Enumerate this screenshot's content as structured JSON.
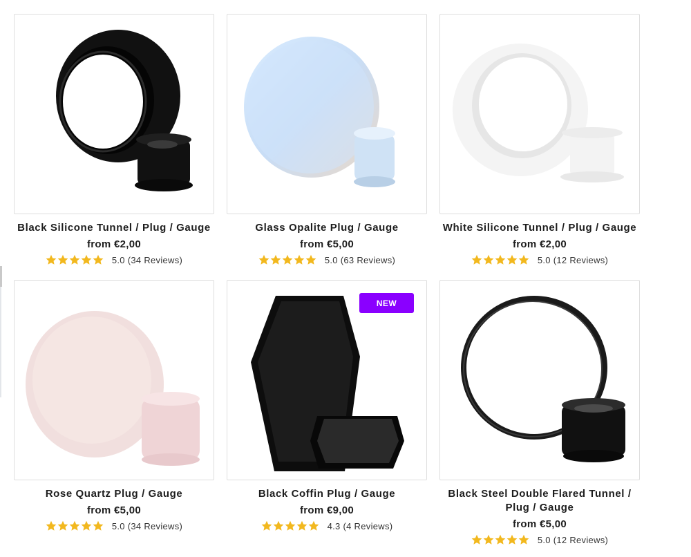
{
  "colors": {
    "star": "#f2b81e",
    "badge": "#8a00ff",
    "border": "#dedede"
  },
  "products": [
    {
      "title": "Black Silicone Tunnel / Plug / Gauge",
      "price_prefix": "from",
      "price": "€2,00",
      "rating": 5,
      "rating_text": "5.0 (34 Reviews)",
      "image_icon": "black-silicone-tunnel-image",
      "badge": ""
    },
    {
      "title": "Glass Opalite Plug / Gauge",
      "price_prefix": "from",
      "price": "€5,00",
      "rating": 5,
      "rating_text": "5.0 (63 Reviews)",
      "image_icon": "opalite-plug-image",
      "badge": ""
    },
    {
      "title": "White Silicone Tunnel / Plug / Gauge",
      "price_prefix": "from",
      "price": "€2,00",
      "rating": 5,
      "rating_text": "5.0 (12 Reviews)",
      "image_icon": "white-silicone-tunnel-image",
      "badge": ""
    },
    {
      "title": "Rose Quartz Plug / Gauge",
      "price_prefix": "from",
      "price": "€5,00",
      "rating": 5,
      "rating_text": "5.0 (34 Reviews)",
      "image_icon": "rose-quartz-plug-image",
      "badge": ""
    },
    {
      "title": "Black Coffin Plug / Gauge",
      "price_prefix": "from",
      "price": "€9,00",
      "rating": 4.3,
      "rating_text": "4.3 (4 Reviews)",
      "image_icon": "black-coffin-plug-image",
      "badge": "NEW"
    },
    {
      "title": "Black Steel Double Flared Tunnel / Plug / Gauge",
      "price_prefix": "from",
      "price": "€5,00",
      "rating": 5,
      "rating_text": "5.0 (12 Reviews)",
      "image_icon": "black-steel-tunnel-image",
      "badge": ""
    }
  ]
}
